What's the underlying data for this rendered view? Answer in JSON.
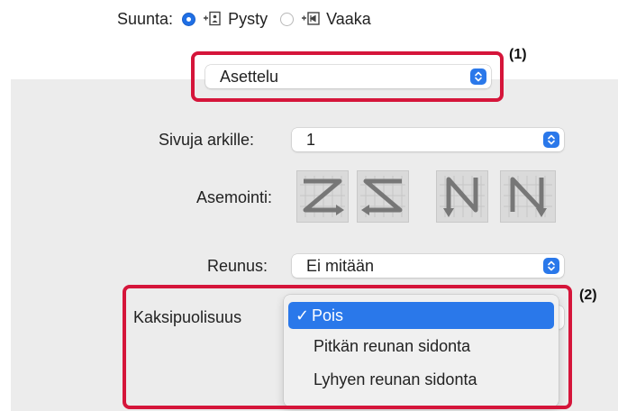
{
  "orientation": {
    "label": "Suunta:",
    "options": [
      {
        "label": "Pysty",
        "selected": true,
        "icon": "portrait-icon"
      },
      {
        "label": "Vaaka",
        "selected": false,
        "icon": "landscape-icon"
      }
    ]
  },
  "section_popup": {
    "value": "Asettelu"
  },
  "callouts": {
    "first": "(1)",
    "second": "(2)"
  },
  "layout": {
    "pages_per_sheet": {
      "label": "Sivuja arkille:",
      "value": "1"
    },
    "layout_direction": {
      "label": "Asemointi:",
      "icons": [
        "z-order-icon",
        "reverse-z-order-icon",
        "n-reverse-order-icon",
        "n-order-icon"
      ]
    },
    "border": {
      "label": "Reunus:",
      "value": "Ei mitään"
    },
    "two_sided": {
      "label": "Kaksipuolisuus"
    }
  },
  "two_sided_menu": {
    "items": [
      {
        "label": "Pois",
        "selected": true,
        "check": "✓"
      },
      {
        "label": "Pitkän reunan sidonta",
        "selected": false
      },
      {
        "label": "Lyhyen reunan sidonta",
        "selected": false
      }
    ]
  },
  "colors": {
    "accent": "#2a78ea",
    "highlight": "#d5153a",
    "panel": "#ececec"
  }
}
